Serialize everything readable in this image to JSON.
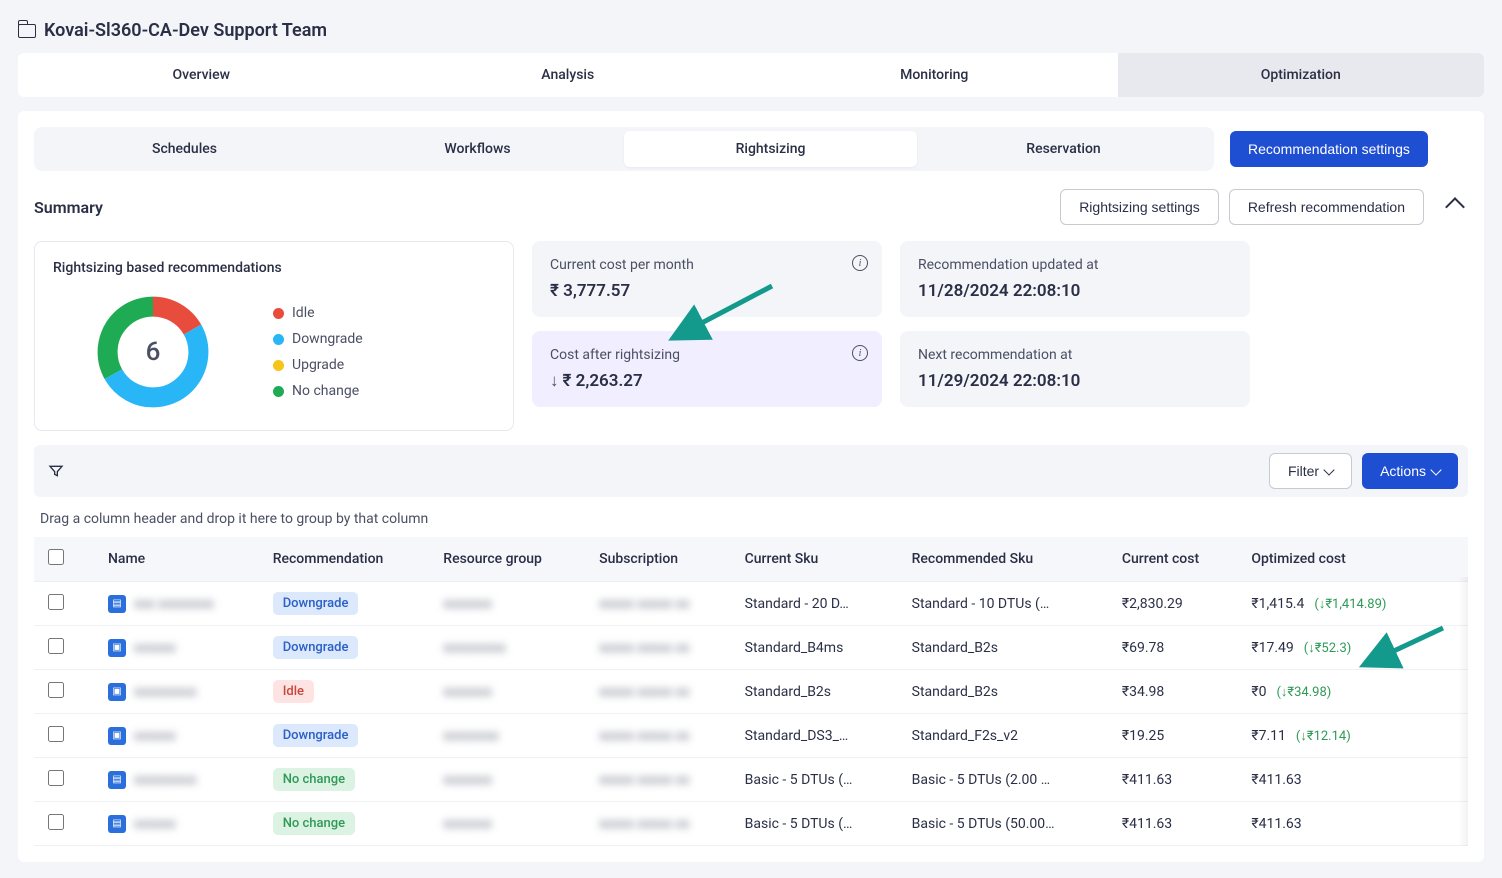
{
  "breadcrumb": {
    "title": "Kovai-Sl360-CA-Dev Support Team"
  },
  "mainTabs": [
    {
      "label": "Overview"
    },
    {
      "label": "Analysis"
    },
    {
      "label": "Monitoring"
    },
    {
      "label": "Optimization",
      "active": true
    }
  ],
  "subTabs": [
    {
      "label": "Schedules"
    },
    {
      "label": "Workflows"
    },
    {
      "label": "Rightsizing",
      "active": true
    },
    {
      "label": "Reservation"
    }
  ],
  "buttons": {
    "recommendationSettings": "Recommendation settings",
    "rightsizingSettings": "Rightsizing settings",
    "refreshRecommendation": "Refresh recommendation",
    "filter": "Filter",
    "actions": "Actions"
  },
  "summary": {
    "heading": "Summary",
    "recoTitle": "Rightsizing based recommendations",
    "total": "6",
    "legend": {
      "idle": {
        "label": "Idle",
        "color": "#e74c3c"
      },
      "down": {
        "label": "Downgrade",
        "color": "#29b6f6"
      },
      "up": {
        "label": "Upgrade",
        "color": "#f5c518"
      },
      "none": {
        "label": "No change",
        "color": "#1fab54"
      }
    },
    "stats": {
      "currentCost": {
        "label": "Current cost per month",
        "value": "₹ 3,777.57"
      },
      "afterCost": {
        "label": "Cost after rightsizing",
        "value": "₹ 2,263.27"
      },
      "updatedAt": {
        "label": "Recommendation updated at",
        "value": "11/28/2024 22:08:10"
      },
      "nextAt": {
        "label": "Next recommendation at",
        "value": "11/29/2024 22:08:10"
      }
    }
  },
  "chart_data": {
    "type": "pie",
    "title": "Rightsizing based recommendations",
    "total": 6,
    "series": [
      {
        "name": "Idle",
        "value": 1,
        "color": "#e74c3c"
      },
      {
        "name": "Downgrade",
        "value": 3,
        "color": "#29b6f6"
      },
      {
        "name": "Upgrade",
        "value": 0,
        "color": "#f5c518"
      },
      {
        "name": "No change",
        "value": 2,
        "color": "#1fab54"
      }
    ]
  },
  "table": {
    "groupHint": "Drag a column header and drop it here to group by that column",
    "columns": {
      "name": "Name",
      "recommendation": "Recommendation",
      "resourceGroup": "Resource group",
      "subscription": "Subscription",
      "currentSku": "Current Sku",
      "recommendedSku": "Recommended Sku",
      "currentCost": "Current cost",
      "optimizedCost": "Optimized cost"
    },
    "rows": [
      {
        "icon": "sql",
        "name": "xxx xxxxxxxx",
        "rec": "Downgrade",
        "recClass": "downgrade",
        "rg": "xxxxxxx",
        "sub": "xxxxx xxxxx xx",
        "curSku": "Standard - 20 D…",
        "recSku": "Standard - 10 DTUs (…",
        "curCost": "₹2,830.29",
        "optCost": "₹1,415.4",
        "delta": "↓₹1,414.89"
      },
      {
        "icon": "vm",
        "name": "xxxxxx",
        "rec": "Downgrade",
        "recClass": "downgrade",
        "rg": "xxxxxxxxx",
        "sub": "xxxxx xxxxx xx",
        "curSku": "Standard_B4ms",
        "recSku": "Standard_B2s",
        "curCost": "₹69.78",
        "optCost": "₹17.49",
        "delta": "↓₹52.3"
      },
      {
        "icon": "vm",
        "name": "xxxxxxxxx",
        "rec": "Idle",
        "recClass": "idle",
        "rg": "xxxxxxx",
        "sub": "xxxxx xxxxx xx",
        "curSku": "Standard_B2s",
        "recSku": "Standard_B2s",
        "curCost": "₹34.98",
        "optCost": "₹0",
        "delta": "↓₹34.98"
      },
      {
        "icon": "vm",
        "name": "xxxxxx",
        "rec": "Downgrade",
        "recClass": "downgrade",
        "rg": "xxxxxxxx",
        "sub": "xxxxx xxxxx xx",
        "curSku": "Standard_DS3_…",
        "recSku": "Standard_F2s_v2",
        "curCost": "₹19.25",
        "optCost": "₹7.11",
        "delta": "↓₹12.14"
      },
      {
        "icon": "sql",
        "name": "xxxxxxxxx",
        "rec": "No change",
        "recClass": "nochange",
        "rg": "xxxxxxx",
        "sub": "xxxxx xxxxx xx",
        "curSku": "Basic - 5 DTUs (…",
        "recSku": "Basic - 5 DTUs (2.00 …",
        "curCost": "₹411.63",
        "optCost": "₹411.63",
        "delta": ""
      },
      {
        "icon": "sql",
        "name": "xxxxxx",
        "rec": "No change",
        "recClass": "nochange",
        "rg": "xxxxxxx",
        "sub": "xxxxx xxxxx xx",
        "curSku": "Basic - 5 DTUs (…",
        "recSku": "Basic - 5 DTUs (50.00…",
        "curCost": "₹411.63",
        "optCost": "₹411.63",
        "delta": ""
      }
    ]
  }
}
